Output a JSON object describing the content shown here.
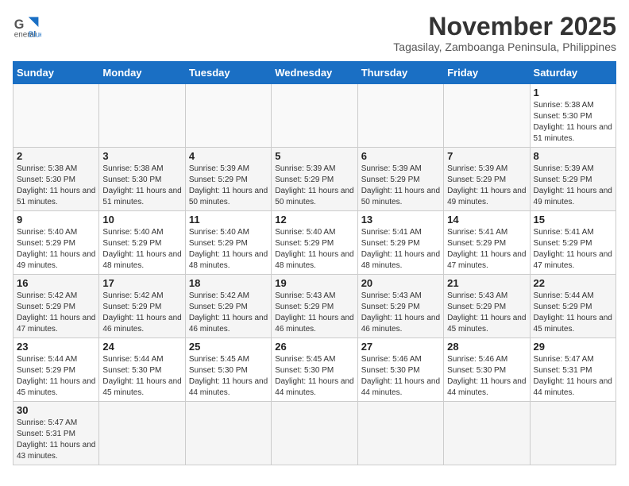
{
  "logo": {
    "line1": "General",
    "line2": "Blue"
  },
  "title": "November 2025",
  "subtitle": "Tagasilay, Zamboanga Peninsula, Philippines",
  "days_header": [
    "Sunday",
    "Monday",
    "Tuesday",
    "Wednesday",
    "Thursday",
    "Friday",
    "Saturday"
  ],
  "weeks": [
    [
      {
        "day": "",
        "info": ""
      },
      {
        "day": "",
        "info": ""
      },
      {
        "day": "",
        "info": ""
      },
      {
        "day": "",
        "info": ""
      },
      {
        "day": "",
        "info": ""
      },
      {
        "day": "",
        "info": ""
      },
      {
        "day": "1",
        "info": "Sunrise: 5:38 AM\nSunset: 5:30 PM\nDaylight: 11 hours\nand 51 minutes."
      }
    ],
    [
      {
        "day": "2",
        "info": "Sunrise: 5:38 AM\nSunset: 5:30 PM\nDaylight: 11 hours\nand 51 minutes."
      },
      {
        "day": "3",
        "info": "Sunrise: 5:38 AM\nSunset: 5:30 PM\nDaylight: 11 hours\nand 51 minutes."
      },
      {
        "day": "4",
        "info": "Sunrise: 5:39 AM\nSunset: 5:29 PM\nDaylight: 11 hours\nand 50 minutes."
      },
      {
        "day": "5",
        "info": "Sunrise: 5:39 AM\nSunset: 5:29 PM\nDaylight: 11 hours\nand 50 minutes."
      },
      {
        "day": "6",
        "info": "Sunrise: 5:39 AM\nSunset: 5:29 PM\nDaylight: 11 hours\nand 50 minutes."
      },
      {
        "day": "7",
        "info": "Sunrise: 5:39 AM\nSunset: 5:29 PM\nDaylight: 11 hours\nand 49 minutes."
      },
      {
        "day": "8",
        "info": "Sunrise: 5:39 AM\nSunset: 5:29 PM\nDaylight: 11 hours\nand 49 minutes."
      }
    ],
    [
      {
        "day": "9",
        "info": "Sunrise: 5:40 AM\nSunset: 5:29 PM\nDaylight: 11 hours\nand 49 minutes."
      },
      {
        "day": "10",
        "info": "Sunrise: 5:40 AM\nSunset: 5:29 PM\nDaylight: 11 hours\nand 48 minutes."
      },
      {
        "day": "11",
        "info": "Sunrise: 5:40 AM\nSunset: 5:29 PM\nDaylight: 11 hours\nand 48 minutes."
      },
      {
        "day": "12",
        "info": "Sunrise: 5:40 AM\nSunset: 5:29 PM\nDaylight: 11 hours\nand 48 minutes."
      },
      {
        "day": "13",
        "info": "Sunrise: 5:41 AM\nSunset: 5:29 PM\nDaylight: 11 hours\nand 48 minutes."
      },
      {
        "day": "14",
        "info": "Sunrise: 5:41 AM\nSunset: 5:29 PM\nDaylight: 11 hours\nand 47 minutes."
      },
      {
        "day": "15",
        "info": "Sunrise: 5:41 AM\nSunset: 5:29 PM\nDaylight: 11 hours\nand 47 minutes."
      }
    ],
    [
      {
        "day": "16",
        "info": "Sunrise: 5:42 AM\nSunset: 5:29 PM\nDaylight: 11 hours\nand 47 minutes."
      },
      {
        "day": "17",
        "info": "Sunrise: 5:42 AM\nSunset: 5:29 PM\nDaylight: 11 hours\nand 46 minutes."
      },
      {
        "day": "18",
        "info": "Sunrise: 5:42 AM\nSunset: 5:29 PM\nDaylight: 11 hours\nand 46 minutes."
      },
      {
        "day": "19",
        "info": "Sunrise: 5:43 AM\nSunset: 5:29 PM\nDaylight: 11 hours\nand 46 minutes."
      },
      {
        "day": "20",
        "info": "Sunrise: 5:43 AM\nSunset: 5:29 PM\nDaylight: 11 hours\nand 46 minutes."
      },
      {
        "day": "21",
        "info": "Sunrise: 5:43 AM\nSunset: 5:29 PM\nDaylight: 11 hours\nand 45 minutes."
      },
      {
        "day": "22",
        "info": "Sunrise: 5:44 AM\nSunset: 5:29 PM\nDaylight: 11 hours\nand 45 minutes."
      }
    ],
    [
      {
        "day": "23",
        "info": "Sunrise: 5:44 AM\nSunset: 5:29 PM\nDaylight: 11 hours\nand 45 minutes."
      },
      {
        "day": "24",
        "info": "Sunrise: 5:44 AM\nSunset: 5:30 PM\nDaylight: 11 hours\nand 45 minutes."
      },
      {
        "day": "25",
        "info": "Sunrise: 5:45 AM\nSunset: 5:30 PM\nDaylight: 11 hours\nand 44 minutes."
      },
      {
        "day": "26",
        "info": "Sunrise: 5:45 AM\nSunset: 5:30 PM\nDaylight: 11 hours\nand 44 minutes."
      },
      {
        "day": "27",
        "info": "Sunrise: 5:46 AM\nSunset: 5:30 PM\nDaylight: 11 hours\nand 44 minutes."
      },
      {
        "day": "28",
        "info": "Sunrise: 5:46 AM\nSunset: 5:30 PM\nDaylight: 11 hours\nand 44 minutes."
      },
      {
        "day": "29",
        "info": "Sunrise: 5:47 AM\nSunset: 5:31 PM\nDaylight: 11 hours\nand 44 minutes."
      }
    ],
    [
      {
        "day": "30",
        "info": "Sunrise: 5:47 AM\nSunset: 5:31 PM\nDaylight: 11 hours\nand 43 minutes."
      },
      {
        "day": "",
        "info": ""
      },
      {
        "day": "",
        "info": ""
      },
      {
        "day": "",
        "info": ""
      },
      {
        "day": "",
        "info": ""
      },
      {
        "day": "",
        "info": ""
      },
      {
        "day": "",
        "info": ""
      }
    ]
  ]
}
